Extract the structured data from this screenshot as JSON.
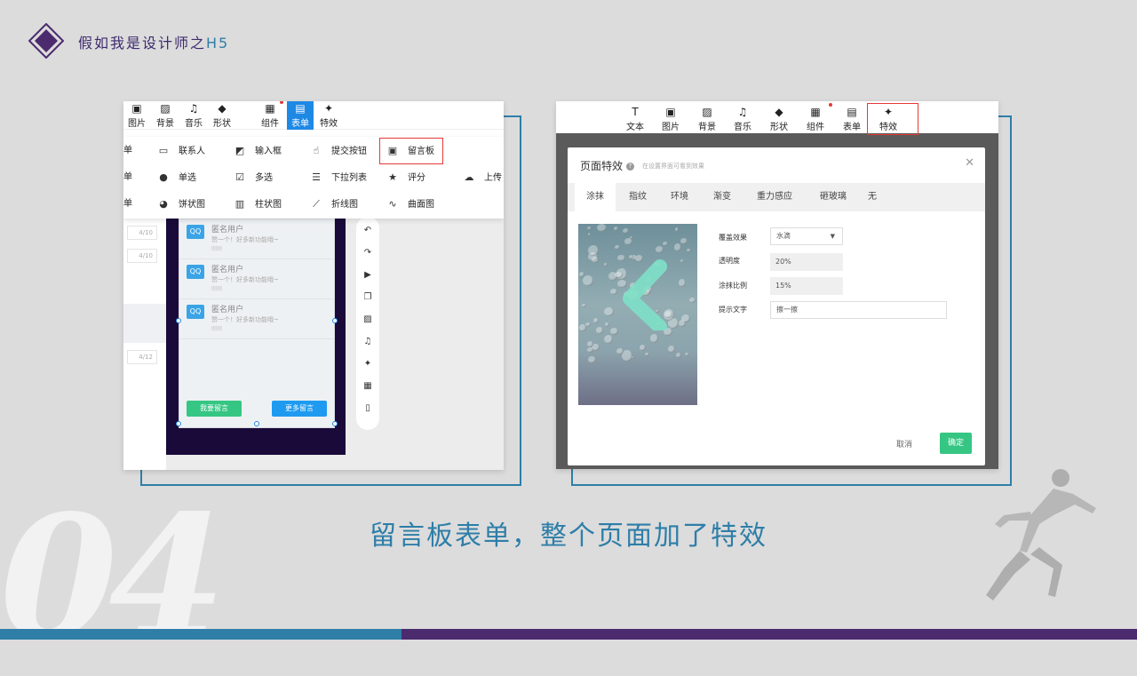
{
  "header": {
    "title": "假如我是设计师之",
    "title_suffix": "H5"
  },
  "bg_number": "04",
  "caption": "留言板表单，整个页面加了特效",
  "left_shot": {
    "toolbar": [
      {
        "icon": "image-icon",
        "glyph": "▣",
        "label": "图片"
      },
      {
        "icon": "background-icon",
        "glyph": "▨",
        "label": "背景"
      },
      {
        "icon": "music-icon",
        "glyph": "♫",
        "label": "音乐"
      },
      {
        "icon": "shape-icon",
        "glyph": "◆",
        "label": "形状"
      },
      {
        "icon": "component-icon",
        "glyph": "▦",
        "label": "组件"
      },
      {
        "icon": "form-icon",
        "glyph": "▤",
        "label": "表单"
      },
      {
        "icon": "effect-icon",
        "glyph": "✦",
        "label": "特效"
      }
    ],
    "form_items": [
      {
        "icon": "contact-icon",
        "glyph": "▭",
        "label": "联系人"
      },
      {
        "icon": "input-icon",
        "glyph": "◩",
        "label": "输入框"
      },
      {
        "icon": "submit-icon",
        "glyph": "☝",
        "label": "提交按钮"
      },
      {
        "icon": "message-icon",
        "glyph": "▣",
        "label": "留言板"
      },
      {
        "icon": "radio-icon",
        "glyph": "●",
        "label": "单选"
      },
      {
        "icon": "checkbox-icon",
        "glyph": "☑",
        "label": "多选"
      },
      {
        "icon": "dropdown-icon",
        "glyph": "☰",
        "label": "下拉列表"
      },
      {
        "icon": "star-icon",
        "glyph": "★",
        "label": "评分"
      },
      {
        "icon": "upload-icon",
        "glyph": "☁",
        "label": "上传"
      },
      {
        "icon": "pie-chart-icon",
        "glyph": "◕",
        "label": "饼状图"
      },
      {
        "icon": "bar-chart-icon",
        "glyph": "▥",
        "label": "柱状图"
      },
      {
        "icon": "line-chart-icon",
        "glyph": "⟋",
        "label": "折线图"
      },
      {
        "icon": "curve-chart-icon",
        "glyph": "∿",
        "label": "曲面图"
      }
    ],
    "partial_labels": [
      "单",
      "单",
      "单"
    ],
    "counts": [
      "4/10",
      "4/10",
      "4/12"
    ],
    "messages": [
      {
        "name": "匿名用户",
        "text": "赞一个！好多新功能哦~",
        "time": "刚刚"
      },
      {
        "name": "匿名用户",
        "text": "赞一个！好多新功能哦~",
        "time": "刚刚"
      },
      {
        "name": "匿名用户",
        "text": "赞一个！好多新功能哦~",
        "time": "刚刚"
      }
    ],
    "avatar_text": "QQ",
    "btn_leave": "我要留言",
    "btn_more": "更多留言",
    "side_tools": [
      "↶",
      "↷",
      "▶",
      "❐",
      "▨",
      "♫",
      "✦",
      "▦",
      "▯"
    ]
  },
  "right_shot": {
    "toolbar": [
      {
        "icon": "text-icon",
        "glyph": "T",
        "label": "文本"
      },
      {
        "icon": "image-icon",
        "glyph": "▣",
        "label": "图片"
      },
      {
        "icon": "background-icon",
        "glyph": "▨",
        "label": "背景"
      },
      {
        "icon": "music-icon",
        "glyph": "♫",
        "label": "音乐"
      },
      {
        "icon": "shape-icon",
        "glyph": "◆",
        "label": "形状"
      },
      {
        "icon": "component-icon",
        "glyph": "▦",
        "label": "组件"
      },
      {
        "icon": "form-icon",
        "glyph": "▤",
        "label": "表单"
      },
      {
        "icon": "effect-icon",
        "glyph": "✦",
        "label": "特效"
      }
    ],
    "dialog": {
      "title": "页面特效",
      "subtitle": "在设置界面可看到效果",
      "tabs": [
        "涂抹",
        "指纹",
        "环境",
        "渐变",
        "重力感应",
        "砸玻璃",
        "无"
      ],
      "fields": [
        {
          "label": "覆盖效果",
          "value": "水滴"
        },
        {
          "label": "透明度",
          "value": "20%"
        },
        {
          "label": "涂抹比例",
          "value": "15%"
        },
        {
          "label": "提示文字",
          "value": "擦一擦"
        }
      ],
      "cancel": "取消",
      "ok": "确定"
    }
  },
  "colors": {
    "accent_blue": "#2e7ea8",
    "accent_purple": "#4b2a6e",
    "green": "#35c683",
    "red": "#e53935"
  }
}
